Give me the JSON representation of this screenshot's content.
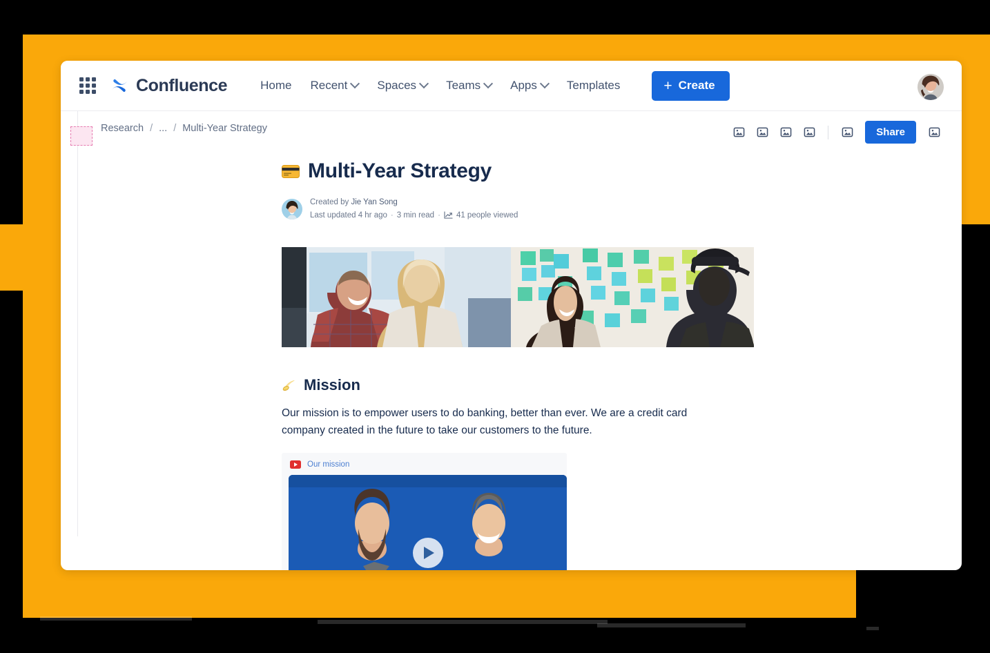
{
  "theme": {
    "orange": "#FAA80A",
    "brand_blue": "#1868DB",
    "text_dark": "#172B4D",
    "text_muted": "#6B778C"
  },
  "topnav": {
    "app_switcher_icon": "grid-apps-icon",
    "brand_logo_icon": "confluence-logo-icon",
    "brand_name": "Confluence",
    "links": [
      {
        "label": "Home",
        "has_dropdown": false
      },
      {
        "label": "Recent",
        "has_dropdown": true
      },
      {
        "label": "Spaces",
        "has_dropdown": true
      },
      {
        "label": "Teams",
        "has_dropdown": true
      },
      {
        "label": "Apps",
        "has_dropdown": true
      },
      {
        "label": "Templates",
        "has_dropdown": false
      }
    ],
    "create_button": {
      "label": "Create",
      "icon": "plus-icon"
    },
    "profile_avatar": "user-avatar"
  },
  "page_chrome": {
    "space_icon_placeholder": "space-avatar-placeholder",
    "breadcrumb": {
      "items": [
        {
          "label": "Research"
        },
        {
          "label": "..."
        },
        {
          "label": "Multi-Year Strategy"
        }
      ],
      "separator": "/"
    },
    "toolbar": {
      "icons": [
        "broken-image-icon",
        "broken-image-icon",
        "broken-image-icon",
        "broken-image-icon"
      ],
      "icons_right": [
        "broken-image-icon"
      ],
      "share_label": "Share",
      "icons_far_right": [
        "broken-image-icon"
      ]
    }
  },
  "document": {
    "title_emoji": "credit-card-emoji",
    "title": "Multi-Year Strategy",
    "byline": {
      "avatar": "author-avatar",
      "created_by_label": "Created by",
      "author": "Jie Yan Song",
      "last_updated": "Last updated 4 hr ago",
      "read_time": "3 min read",
      "views_icon": "analytics-chart-icon",
      "views": "41 people viewed",
      "separator": "·"
    },
    "hero_images": [
      {
        "name": "team-conversation-photo",
        "alt": "Two colleagues talking in an office"
      },
      {
        "name": "sticky-notes-workshop-photo",
        "alt": "Team at a wall of sticky notes"
      }
    ],
    "sections": [
      {
        "emoji": "dizzy-sparkle-emoji",
        "heading": "Mission",
        "paragraph": "Our mission is to empower users to do banking, better than ever. We are a credit card company created in the future to take our customers to the future.",
        "video": {
          "provider_icon": "youtube-play-icon",
          "title": "Our mission",
          "play_button_icon": "play-icon",
          "thumbnail": "two-founders-blue-backdrop-photo"
        }
      }
    ]
  }
}
